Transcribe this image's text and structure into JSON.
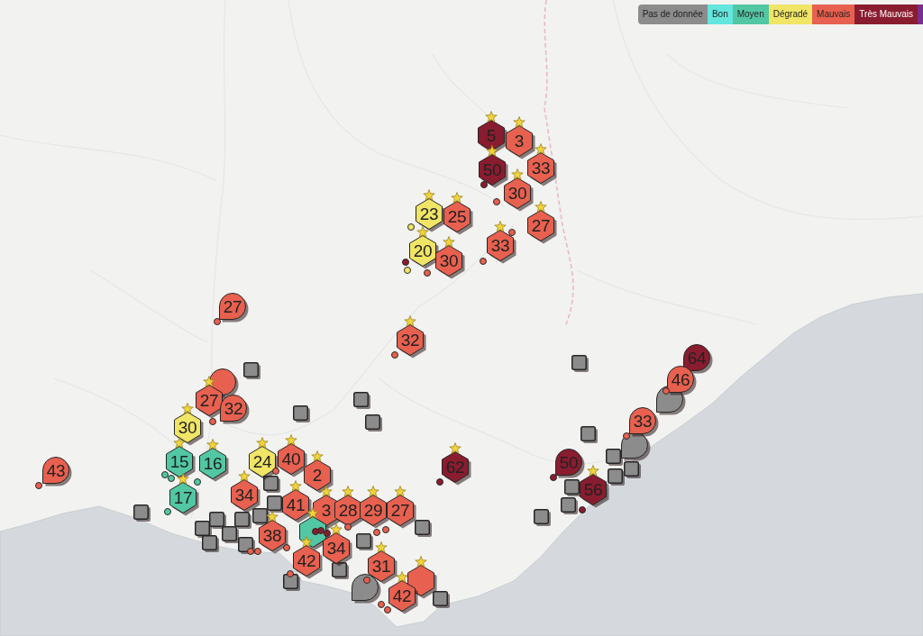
{
  "legend": [
    {
      "label": "Pas de donnée",
      "color": "#8c8c8c"
    },
    {
      "label": "Bon",
      "color": "#62e6de"
    },
    {
      "label": "Moyen",
      "color": "#52c7a3"
    },
    {
      "label": "Dégradé",
      "color": "#f0e566"
    },
    {
      "label": "Mauvais",
      "color": "#e8604f"
    },
    {
      "label": "Très Mauvais",
      "color": "#8a1c2f"
    },
    {
      "color": "#7a2f8c"
    }
  ],
  "markers": [
    {
      "kind": "square",
      "color": "#8c8c8c"
    },
    {
      "kind": "square",
      "color": "#8c8c8c"
    },
    {
      "kind": "square",
      "color": "#8c8c8c"
    },
    {
      "kind": "square",
      "color": "#8c8c8c"
    },
    {
      "kind": "square",
      "color": "#8c8c8c"
    },
    {
      "kind": "square",
      "color": "#8c8c8c"
    },
    {
      "kind": "square",
      "color": "#8c8c8c"
    },
    {
      "kind": "square",
      "color": "#8c8c8c"
    },
    {
      "kind": "square",
      "color": "#8c8c8c"
    },
    {
      "kind": "square",
      "color": "#8c8c8c"
    },
    {
      "kind": "square",
      "color": "#8c8c8c"
    },
    {
      "kind": "square",
      "color": "#8c8c8c"
    },
    {
      "kind": "square",
      "color": "#8c8c8c"
    },
    {
      "kind": "square",
      "color": "#8c8c8c"
    },
    {
      "kind": "square",
      "color": "#8c8c8c"
    },
    {
      "kind": "square",
      "color": "#8c8c8c"
    },
    {
      "kind": "square",
      "color": "#8c8c8c"
    },
    {
      "kind": "square",
      "color": "#8c8c8c"
    },
    {
      "kind": "square",
      "color": "#8c8c8c"
    },
    {
      "kind": "square",
      "color": "#8c8c8c"
    },
    {
      "kind": "square",
      "color": "#8c8c8c"
    },
    {
      "kind": "square",
      "color": "#8c8c8c"
    },
    {
      "kind": "square",
      "color": "#8c8c8c"
    },
    {
      "kind": "square",
      "color": "#8c8c8c"
    },
    {
      "kind": "square",
      "color": "#8c8c8c"
    },
    {
      "kind": "square",
      "color": "#8c8c8c"
    },
    {
      "kind": "square",
      "color": "#8c8c8c"
    },
    {
      "kind": "balloon",
      "color": "#8c8c8c"
    },
    {
      "kind": "balloon",
      "color": "#8c8c8c"
    },
    {
      "kind": "balloon",
      "color": "#8c8c8c"
    },
    {
      "kind": "hexagon",
      "value": "5",
      "color": "#8a1c2f"
    },
    {
      "kind": "hexagon",
      "value": "3",
      "color": "#e8604f"
    },
    {
      "kind": "hexagon",
      "value": "33",
      "color": "#e8604f"
    },
    {
      "kind": "hexagon",
      "value": "50",
      "color": "#8a1c2f"
    },
    {
      "kind": "hexagon",
      "value": "30",
      "color": "#e8604f"
    },
    {
      "kind": "hexagon",
      "value": "27",
      "color": "#e8604f"
    },
    {
      "kind": "hexagon",
      "value": "33",
      "color": "#e8604f"
    },
    {
      "kind": "hexagon",
      "value": "23",
      "color": "#f0e566"
    },
    {
      "kind": "hexagon",
      "value": "25",
      "color": "#e8604f"
    },
    {
      "kind": "hexagon",
      "value": "20",
      "color": "#f0e566"
    },
    {
      "kind": "hexagon",
      "value": "30",
      "color": "#e8604f"
    },
    {
      "kind": "balloon",
      "value": "27",
      "color": "#e8604f"
    },
    {
      "kind": "hexagon",
      "value": "32",
      "color": "#e8604f"
    },
    {
      "kind": "balloon",
      "color": "#e8604f"
    },
    {
      "kind": "hexagon",
      "value": "27",
      "color": "#e8604f"
    },
    {
      "kind": "balloon",
      "value": "32",
      "color": "#e8604f"
    },
    {
      "kind": "hexagon",
      "value": "30",
      "color": "#f0e566"
    },
    {
      "kind": "hexagon",
      "value": "15",
      "color": "#52c7a3"
    },
    {
      "kind": "hexagon",
      "value": "16",
      "color": "#52c7a3"
    },
    {
      "kind": "hexagon",
      "value": "17",
      "color": "#52c7a3"
    },
    {
      "kind": "hexagon",
      "value": "24",
      "color": "#f0e566"
    },
    {
      "kind": "hexagon",
      "value": "40",
      "color": "#e8604f"
    },
    {
      "kind": "hexagon",
      "value": "34",
      "color": "#e8604f"
    },
    {
      "kind": "balloon",
      "value": "43",
      "color": "#e8604f"
    },
    {
      "kind": "hexagon",
      "value": "2",
      "color": "#e8604f"
    },
    {
      "kind": "hexagon",
      "value": "41",
      "color": "#e8604f"
    },
    {
      "kind": "hexagon",
      "value": "3",
      "color": "#e8604f"
    },
    {
      "kind": "hexagon",
      "value": "28",
      "color": "#e8604f"
    },
    {
      "kind": "hexagon",
      "value": "29",
      "color": "#e8604f"
    },
    {
      "kind": "hexagon",
      "value": "27",
      "color": "#e8604f"
    },
    {
      "kind": "hexagon",
      "color": "#52c7a3"
    },
    {
      "kind": "hexagon",
      "value": "38",
      "color": "#e8604f"
    },
    {
      "kind": "hexagon",
      "value": "34",
      "color": "#e8604f"
    },
    {
      "kind": "hexagon",
      "value": "42",
      "color": "#e8604f"
    },
    {
      "kind": "hexagon",
      "value": "31",
      "color": "#e8604f"
    },
    {
      "kind": "hexagon",
      "color": "#e8604f"
    },
    {
      "kind": "hexagon",
      "value": "42",
      "color": "#e8604f"
    },
    {
      "kind": "hexagon",
      "value": "62",
      "color": "#8a1c2f"
    },
    {
      "kind": "balloon",
      "value": "50",
      "color": "#8a1c2f"
    },
    {
      "kind": "hexagon",
      "value": "56",
      "color": "#8a1c2f"
    },
    {
      "kind": "balloon",
      "value": "33",
      "color": "#e8604f"
    },
    {
      "kind": "balloon",
      "value": "64",
      "color": "#8a1c2f"
    },
    {
      "kind": "balloon",
      "value": "46",
      "color": "#e8604f"
    }
  ],
  "dots": [
    {
      "color": "#8a1c2f"
    },
    {
      "color": "#e8604f"
    },
    {
      "color": "#e8604f"
    },
    {
      "color": "#e8604f"
    },
    {
      "color": "#f0e566"
    },
    {
      "color": "#8a1c2f"
    },
    {
      "color": "#f0e566"
    },
    {
      "color": "#e8604f"
    },
    {
      "color": "#e8604f"
    },
    {
      "color": "#e8604f"
    },
    {
      "color": "#e8604f"
    },
    {
      "color": "#52c7a3"
    },
    {
      "color": "#52c7a3"
    },
    {
      "color": "#52c7a3"
    },
    {
      "color": "#52c7a3"
    },
    {
      "color": "#e8604f"
    },
    {
      "color": "#e8604f"
    },
    {
      "color": "#e8604f"
    },
    {
      "color": "#e8604f"
    },
    {
      "color": "#e8604f"
    },
    {
      "color": "#e8604f"
    },
    {
      "color": "#e8604f"
    },
    {
      "color": "#e8604f"
    },
    {
      "color": "#e8604f"
    },
    {
      "color": "#e8604f"
    },
    {
      "color": "#e8604f"
    },
    {
      "color": "#e8604f"
    },
    {
      "color": "#8a1c2f"
    },
    {
      "color": "#8a1c2f"
    },
    {
      "color": "#8a1c2f"
    },
    {
      "color": "#e8604f"
    },
    {
      "color": "#e8604f"
    },
    {
      "color": "#8a1c2f"
    },
    {
      "color": "#8a1c2f"
    },
    {
      "color": "#8a1c2f"
    }
  ]
}
